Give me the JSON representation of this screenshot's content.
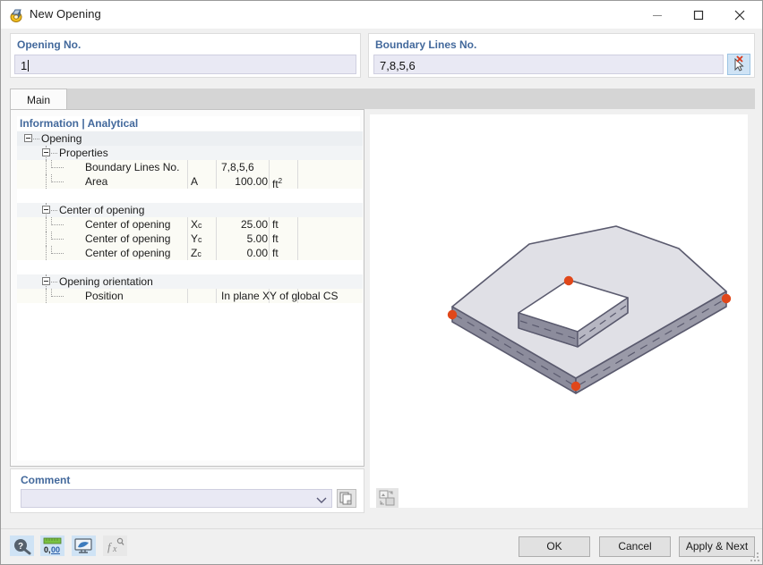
{
  "window": {
    "title": "New Opening",
    "icon": "opening-icon",
    "controls": {
      "minimize": "minimize-icon",
      "maximize": "maximize-icon",
      "close": "close-icon"
    }
  },
  "opening_no": {
    "label": "Opening No.",
    "value": "1"
  },
  "boundary_lines": {
    "label": "Boundary Lines No.",
    "value": "7,8,5,6",
    "pick_button_icon": "select-cursor-icon"
  },
  "tabs": [
    {
      "label": "Main",
      "active": true
    }
  ],
  "tree": {
    "header": "Information | Analytical",
    "rows": [
      {
        "kind": "group0",
        "indent": 8,
        "expander": true,
        "name": "Opening",
        "symbol": "",
        "value": "",
        "unit": ""
      },
      {
        "kind": "group1",
        "indent": 28,
        "expander": true,
        "name": "Properties",
        "symbol": "",
        "value": "",
        "unit": ""
      },
      {
        "kind": "data",
        "indent": 56,
        "expander": false,
        "name": "Boundary Lines No.",
        "symbol": "",
        "value": "7,8,5,6",
        "unit": "",
        "value_align": "left"
      },
      {
        "kind": "data",
        "indent": 56,
        "expander": false,
        "name": "Area",
        "symbol": "A",
        "value": "100.00",
        "unit": "ft²"
      },
      {
        "kind": "spacer",
        "indent": 0,
        "expander": false,
        "name": "",
        "symbol": "",
        "value": "",
        "unit": ""
      },
      {
        "kind": "group1",
        "indent": 28,
        "expander": true,
        "name": "Center of opening",
        "symbol": "",
        "value": "",
        "unit": ""
      },
      {
        "kind": "data",
        "indent": 56,
        "expander": false,
        "name": "Center of opening",
        "symbol": "Xc",
        "value": "25.00",
        "unit": "ft"
      },
      {
        "kind": "data",
        "indent": 56,
        "expander": false,
        "name": "Center of opening",
        "symbol": "Yc",
        "value": "5.00",
        "unit": "ft"
      },
      {
        "kind": "data",
        "indent": 56,
        "expander": false,
        "name": "Center of opening",
        "symbol": "Zc",
        "value": "0.00",
        "unit": "ft"
      },
      {
        "kind": "spacer",
        "indent": 0,
        "expander": false,
        "name": "",
        "symbol": "",
        "value": "",
        "unit": ""
      },
      {
        "kind": "group1",
        "indent": 28,
        "expander": true,
        "name": "Opening orientation",
        "symbol": "",
        "value": "",
        "unit": ""
      },
      {
        "kind": "data",
        "indent": 56,
        "expander": false,
        "name": "Position",
        "symbol": "",
        "value": "In plane XY of global CS",
        "unit": "",
        "value_align": "left"
      }
    ]
  },
  "viewport": {
    "name": "3d-model-preview",
    "settings_button_icon": "view-settings-icon",
    "node_color": "#e0471a",
    "face_top_color": "#e0e0e6",
    "face_side_color": "#8c8c9c",
    "edge_color": "#5a5a6e"
  },
  "comment": {
    "label": "Comment",
    "value": "",
    "placeholder": "",
    "dropdown_icon": "chevron-down-icon",
    "copy_button_icon": "copy-icon"
  },
  "footer": {
    "toolbar": [
      {
        "name": "help-button",
        "icon": "question-mark-icon",
        "enabled": true
      },
      {
        "name": "units-button",
        "icon": "decimal-places-icon",
        "label": "0,00",
        "enabled": true
      },
      {
        "name": "display-button",
        "icon": "monitor-icon",
        "enabled": true
      },
      {
        "name": "formula-button",
        "icon": "fx-icon",
        "enabled": false
      }
    ],
    "buttons": {
      "ok": "OK",
      "cancel": "Cancel",
      "apply_next": "Apply & Next"
    }
  }
}
